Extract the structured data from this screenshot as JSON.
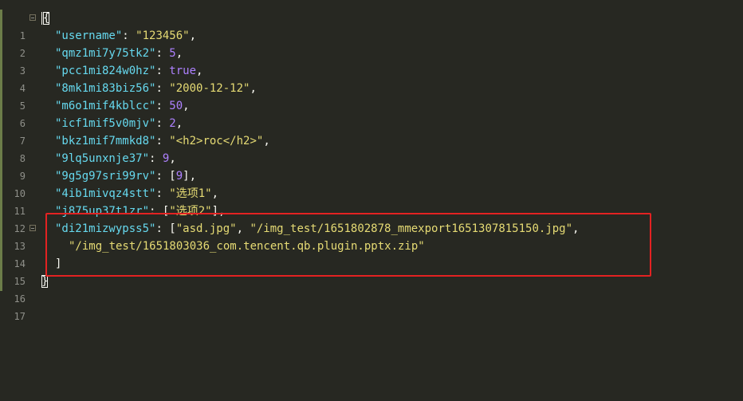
{
  "editor": {
    "theme_colors": {
      "background": "#272822",
      "key": "#66d9ef",
      "string": "#e6db74",
      "number": "#ae81ff",
      "highlight": "#e32222"
    },
    "line_numbers": [
      "1",
      "2",
      "3",
      "4",
      "5",
      "6",
      "7",
      "8",
      "9",
      "10",
      "11",
      "12",
      "13",
      "14",
      "15",
      "16",
      "17"
    ],
    "lines": {
      "l1_open": "{",
      "l2_key": "\"username\"",
      "l2_val": "\"123456\"",
      "l3_key": "\"qmz1mi7y75tk2\"",
      "l3_val": "5",
      "l4_key": "\"pcc1mi824w0hz\"",
      "l4_val": "true",
      "l5_key": "\"8mk1mi83biz56\"",
      "l5_val": "\"2000-12-12\"",
      "l6_key": "\"m6o1mif4kblcc\"",
      "l6_val": "50",
      "l7_key": "\"icf1mif5v0mjv\"",
      "l7_val": "2",
      "l8_key": "\"bkz1mif7mmkd8\"",
      "l8_val": "\"<h2>roc</h2>\"",
      "l9_key": "\"9lq5unxnje37\"",
      "l9_val": "9",
      "l10_key": "\"9g5g97sri99rv\"",
      "l10_val": "9",
      "l11_key": "\"4ib1mivqz4stt\"",
      "l11_val": "\"选项1\"",
      "l12_key": "\"j875up37t1zr\"",
      "l12_val": "\"选项2\"",
      "l13_key": "\"di21mizwypss5\"",
      "l13_val1": "\"asd.jpg\"",
      "l13_val2": "\"/img_test/1651802878_mmexport1651307815150.jpg\"",
      "l14_val": "\"/img_test/1651803036_com.tencent.qb.plugin.pptx.zip\"",
      "l15_close": "]",
      "l16_close": "}"
    }
  }
}
